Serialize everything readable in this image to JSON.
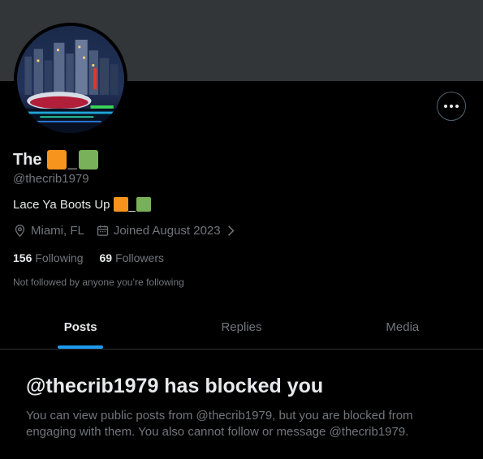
{
  "profile": {
    "display_name": "The",
    "name_separator": "_",
    "handle": "@thecrib1979",
    "bio_text": "Lace Ya Boots Up",
    "bio_separator": "_",
    "location": "Miami, FL",
    "joined": "Joined August 2023",
    "following_count": "156",
    "following_label": "Following",
    "followers_count": "69",
    "followers_label": "Followers",
    "not_followed_text": "Not followed by anyone you’re following"
  },
  "icons": {
    "more": "more-horizontal-icon",
    "location": "location-pin-icon",
    "calendar": "calendar-icon",
    "chevron": "chevron-right-icon"
  },
  "emoji_colors": {
    "orange_square": "#f7941d",
    "green_square": "#78b159"
  },
  "tabs": [
    {
      "label": "Posts",
      "active": true
    },
    {
      "label": "Replies",
      "active": false
    },
    {
      "label": "Media",
      "active": false
    }
  ],
  "blocked": {
    "title": "@thecrib1979 has blocked you",
    "message": "You can view public posts from @thecrib1979, but you are blocked from engaging with them. You also cannot follow or message @thecrib1979."
  },
  "colors": {
    "background": "#000000",
    "banner": "#333639",
    "text_primary": "#e7e9ea",
    "text_secondary": "#71767b",
    "accent": "#1d9bf0",
    "divider": "#2f3336"
  }
}
